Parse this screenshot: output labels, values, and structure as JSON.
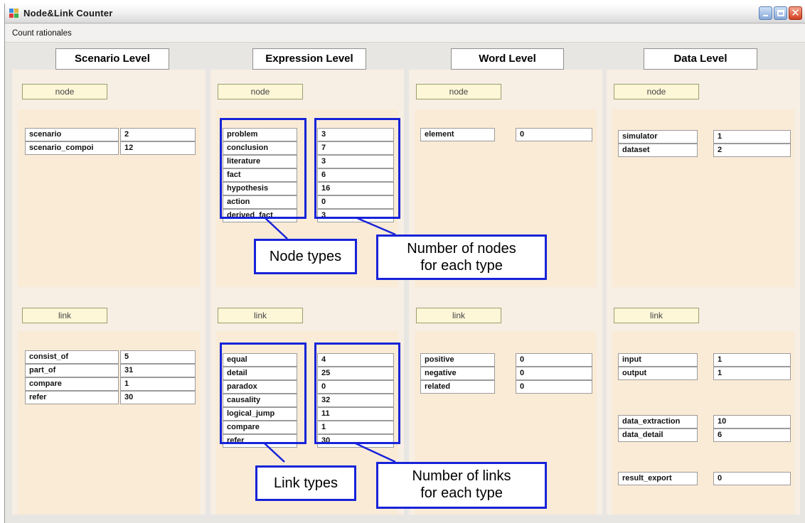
{
  "window": {
    "title": "Node&Link Counter",
    "menu": [
      "Count rationales"
    ],
    "minimize_icon": "minimize-icon",
    "maximize_icon": "maximize-icon",
    "close_icon": "close-icon",
    "close_glyph": "✕"
  },
  "levels": {
    "scenario": "Scenario Level",
    "expression": "Expression Level",
    "word": "Word Level",
    "data": "Data Level"
  },
  "labels": {
    "node": "node",
    "link": "link"
  },
  "scenario": {
    "nodes": [
      {
        "type": "scenario",
        "count": "2"
      },
      {
        "type": "scenario_compoi",
        "count": "12"
      }
    ],
    "links": [
      {
        "type": "consist_of",
        "count": "5"
      },
      {
        "type": "part_of",
        "count": "31"
      },
      {
        "type": "compare",
        "count": "1"
      },
      {
        "type": "refer",
        "count": "30"
      }
    ]
  },
  "expression": {
    "nodes": [
      {
        "type": "problem",
        "count": "3"
      },
      {
        "type": "conclusion",
        "count": "7"
      },
      {
        "type": "literature",
        "count": "3"
      },
      {
        "type": "fact",
        "count": "6"
      },
      {
        "type": "hypothesis",
        "count": "16"
      },
      {
        "type": "action",
        "count": "0"
      },
      {
        "type": "derived_fact",
        "count": "3"
      }
    ],
    "links": [
      {
        "type": "equal",
        "count": "4"
      },
      {
        "type": "detail",
        "count": "25"
      },
      {
        "type": "paradox",
        "count": "0"
      },
      {
        "type": "causality",
        "count": "32"
      },
      {
        "type": "logical_jump",
        "count": "11"
      },
      {
        "type": "compare",
        "count": "1"
      },
      {
        "type": "refer",
        "count": "30"
      }
    ]
  },
  "word": {
    "nodes": [
      {
        "type": "element",
        "count": "0"
      }
    ],
    "links": [
      {
        "type": "positive",
        "count": "0"
      },
      {
        "type": "negative",
        "count": "0"
      },
      {
        "type": "related",
        "count": "0"
      }
    ]
  },
  "data": {
    "nodes": [
      {
        "type": "simulator",
        "count": "1"
      },
      {
        "type": "dataset",
        "count": "2"
      }
    ],
    "links": [
      {
        "type": "input",
        "count": "1"
      },
      {
        "type": "output",
        "count": "1"
      },
      {
        "type": "data_extraction",
        "count": "10"
      },
      {
        "type": "data_detail",
        "count": "6"
      },
      {
        "type": "result_export",
        "count": "0"
      }
    ]
  },
  "annotations": {
    "node_types": "Node types",
    "nodes_per_type_line1": "Number of nodes",
    "nodes_per_type_line2": "for each type",
    "link_types": "Link types",
    "links_per_type_line1": "Number of links",
    "links_per_type_line2": "for each type",
    "highlight_color": "#1723d8"
  },
  "colors": {
    "panel_bg": "#f7eee4",
    "inner_bg": "#faebd7",
    "section_label_bg": "#fdf6d7",
    "window_bg": "#e8e6e2"
  }
}
